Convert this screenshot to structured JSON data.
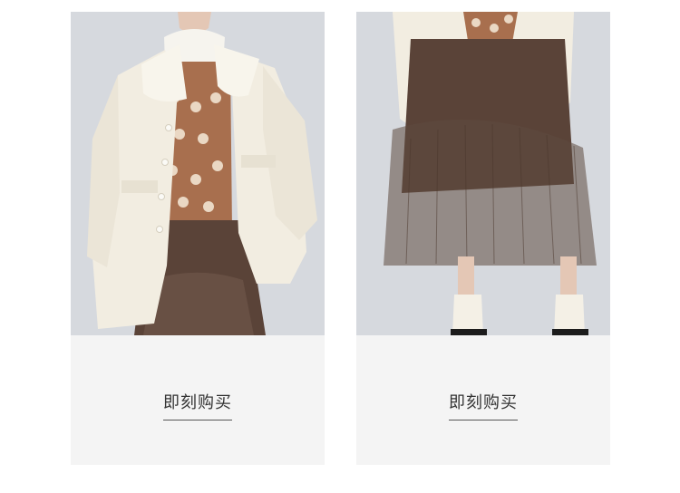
{
  "products": [
    {
      "image_alt": "",
      "buy_label": "即刻购买"
    },
    {
      "image_alt": "",
      "buy_label": "即刻购买"
    }
  ],
  "colors": {
    "background": "#ffffff",
    "card_bg": "#f4f4f4",
    "photo_bg": "#d6d9de",
    "coat": "#f2ede1",
    "skirt": "#5a4338",
    "sweater": "#a86f4e",
    "text": "#333333"
  }
}
